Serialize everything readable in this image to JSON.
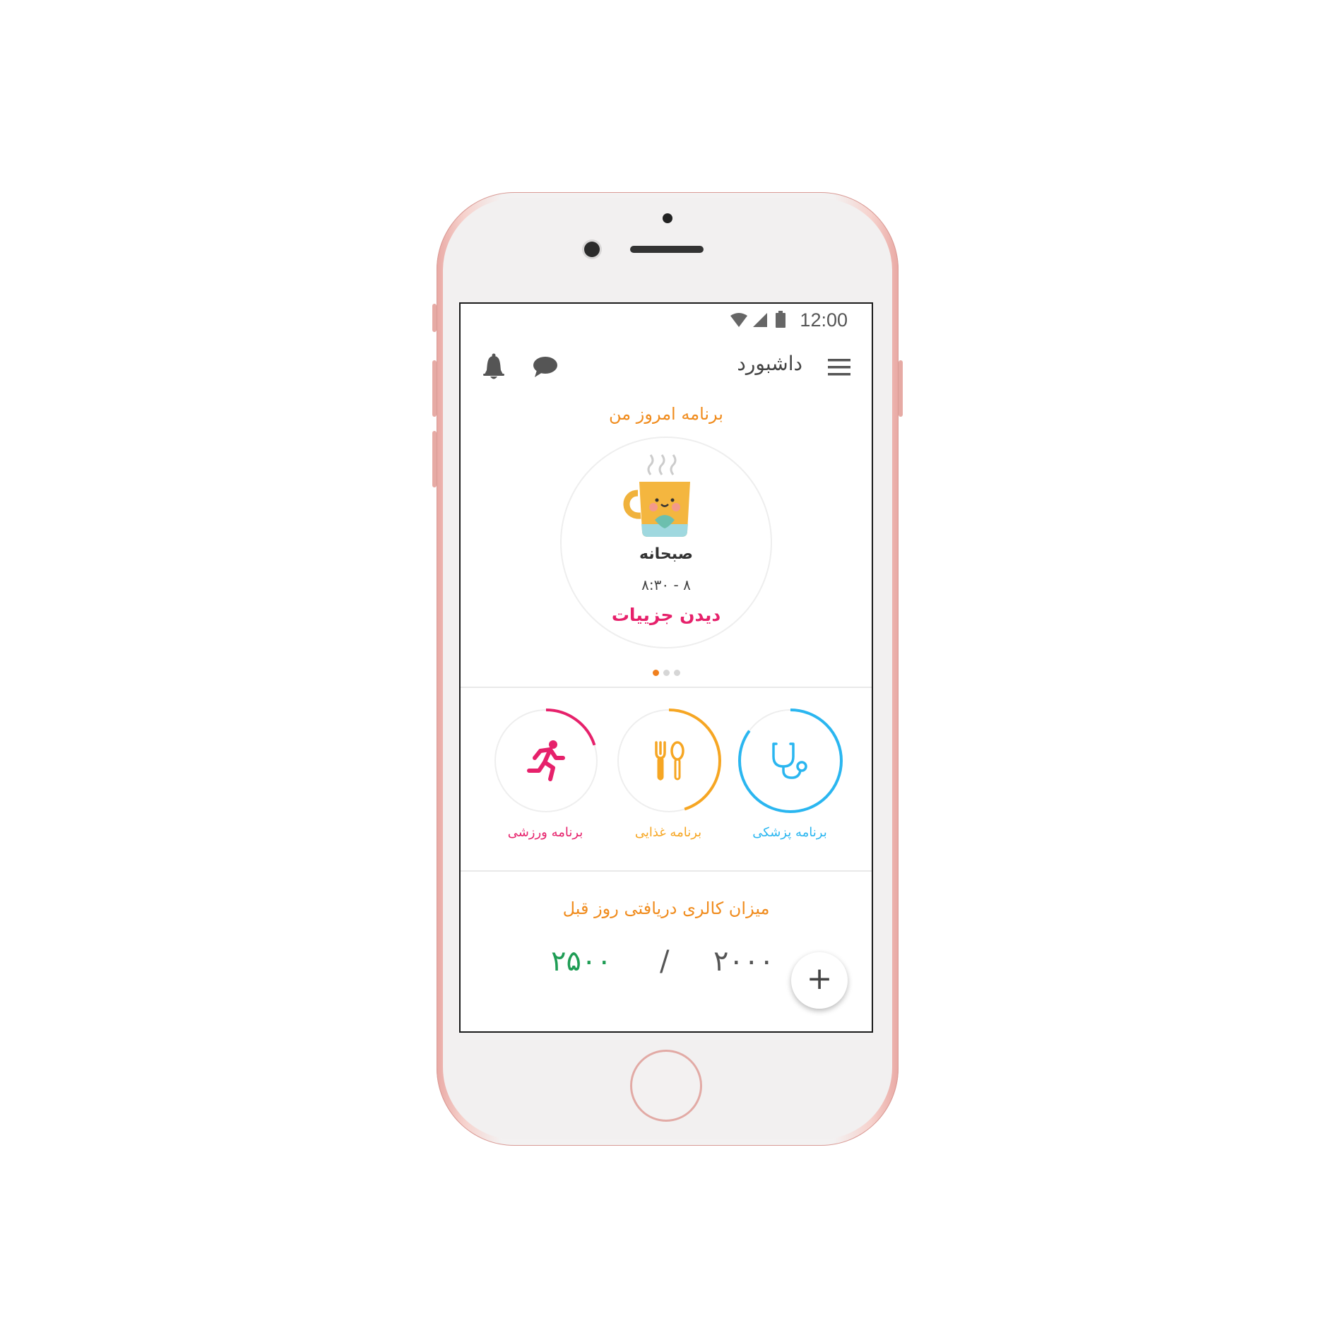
{
  "status_bar": {
    "time": "12:00"
  },
  "header": {
    "title": "داشبورد"
  },
  "today_plan": {
    "section_title": "برنامه امروز من",
    "meal_name": "صبحانه",
    "meal_time": "۸ - ۸:۳۰",
    "details_link": "دیدن جزییات",
    "carousel_pages": 3,
    "active_page": 1
  },
  "programs": [
    {
      "label": "برنامه پزشکی",
      "icon": "stethoscope-icon",
      "color": "#2ab6f0",
      "progress": 0.85
    },
    {
      "label": "برنامه غذایی",
      "icon": "fork-spoon-icon",
      "color": "#f6a623",
      "progress": 0.45
    },
    {
      "label": "برنامه ورزشی",
      "icon": "running-icon",
      "color": "#e6216b",
      "progress": 0.2
    }
  ],
  "calories": {
    "section_title": "میزان کالری دریافتی روز قبل",
    "current": "۲۰۰۰",
    "separator": "/",
    "target": "۲۵۰۰",
    "add_label": "+"
  },
  "colors": {
    "accent_orange": "#f08c1e",
    "pink": "#e6216b",
    "green": "#1f9d55"
  }
}
